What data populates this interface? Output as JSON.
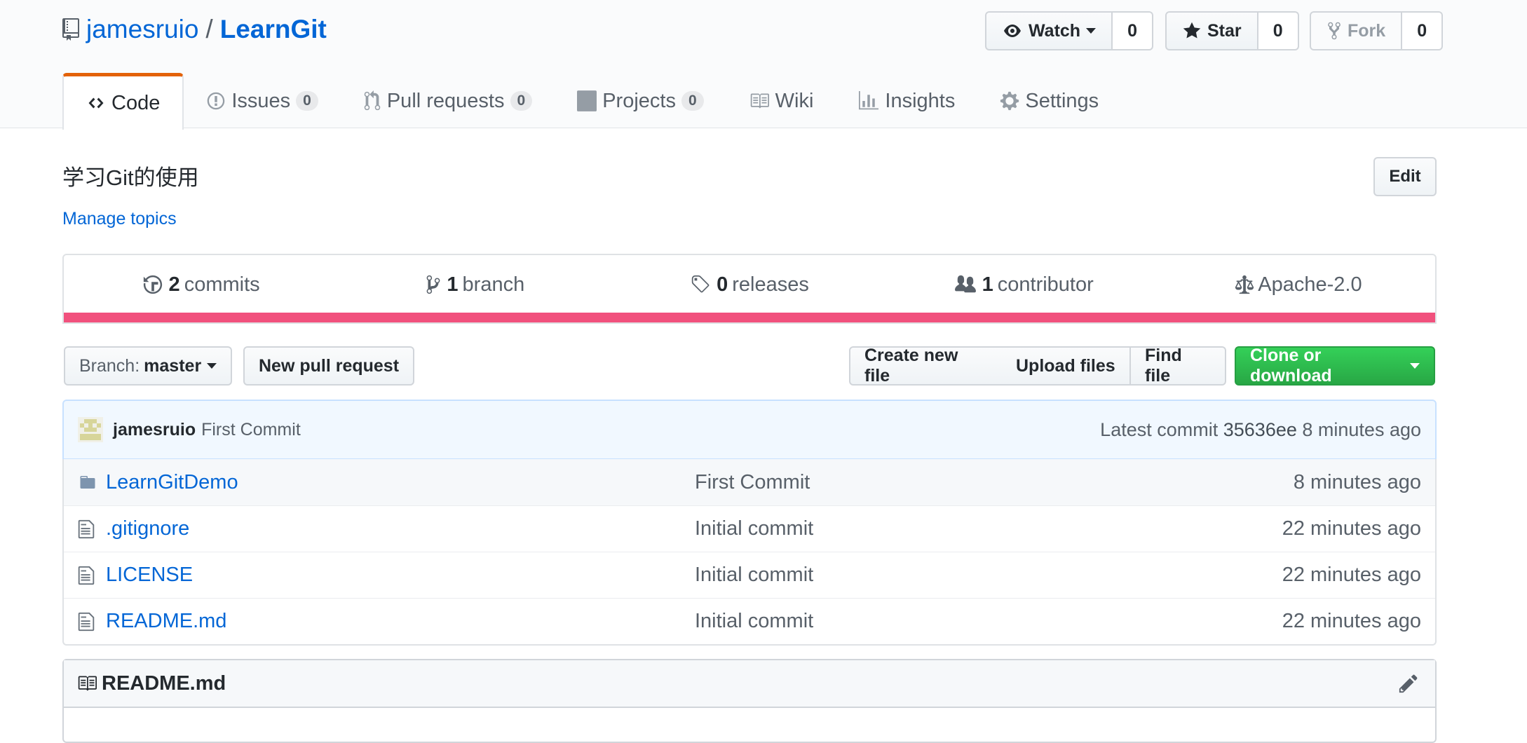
{
  "repo": {
    "owner": "jamesruio",
    "separator": "/",
    "name": "LearnGit"
  },
  "social": {
    "watch": {
      "label": "Watch",
      "count": "0"
    },
    "star": {
      "label": "Star",
      "count": "0"
    },
    "fork": {
      "label": "Fork",
      "count": "0"
    }
  },
  "tabs": [
    {
      "label": "Code",
      "icon": "code-icon"
    },
    {
      "label": "Issues",
      "count": "0",
      "icon": "issue-icon"
    },
    {
      "label": "Pull requests",
      "count": "0",
      "icon": "pull-request-icon"
    },
    {
      "label": "Projects",
      "count": "0",
      "icon": "project-icon"
    },
    {
      "label": "Wiki",
      "icon": "book-icon"
    },
    {
      "label": "Insights",
      "icon": "graph-icon"
    },
    {
      "label": "Settings",
      "icon": "gear-icon"
    }
  ],
  "description": "学习Git的使用",
  "edit_label": "Edit",
  "manage_topics": "Manage topics",
  "summary": {
    "commits": {
      "num": "2",
      "label": "commits"
    },
    "branches": {
      "num": "1",
      "label": "branch"
    },
    "releases": {
      "num": "0",
      "label": "releases"
    },
    "contributors": {
      "num": "1",
      "label": "contributor"
    },
    "license": "Apache-2.0",
    "language_color": "#f1517d"
  },
  "filebar": {
    "branch_prefix": "Branch:",
    "branch_name": "master",
    "new_pr": "New pull request",
    "create_file": "Create new file",
    "upload_files": "Upload files",
    "find_file": "Find file",
    "clone": "Clone or download"
  },
  "latest_commit": {
    "author": "jamesruio",
    "message": "First Commit",
    "prefix": "Latest commit",
    "sha": "35636ee",
    "age": "8 minutes ago"
  },
  "files": [
    {
      "name": "LearnGitDemo",
      "type": "folder",
      "message": "First Commit",
      "age": "8 minutes ago"
    },
    {
      "name": ".gitignore",
      "type": "file",
      "message": "Initial commit",
      "age": "22 minutes ago"
    },
    {
      "name": "LICENSE",
      "type": "file",
      "message": "Initial commit",
      "age": "22 minutes ago"
    },
    {
      "name": "README.md",
      "type": "file",
      "message": "Initial commit",
      "age": "22 minutes ago"
    }
  ],
  "readme": {
    "title": "README.md"
  },
  "colors": {
    "link": "#0366d6",
    "accent_tab": "#e36209",
    "green": "#28a745"
  }
}
